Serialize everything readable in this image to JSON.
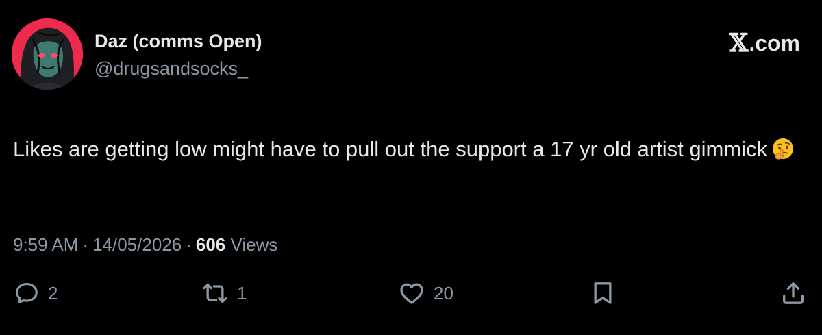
{
  "author": {
    "display_name": "Daz (comms Open)",
    "handle": "@drugsandsocks_"
  },
  "brand": {
    "mark": "𝕏",
    "suffix": ".com"
  },
  "tweet": {
    "text": "Likes are getting low might have to pull out the support a 17 yr old artist gimmick",
    "emoji": "thinking-face"
  },
  "meta": {
    "time": "9:59 AM",
    "separator": "·",
    "date": "14/05/2026",
    "views_count": "606",
    "views_label": "Views"
  },
  "actions": {
    "replies": "2",
    "reposts": "1",
    "likes": "20"
  },
  "colors": {
    "background": "#000000",
    "text": "#e7e9ea",
    "secondary": "#8b98a5",
    "avatar_bg": "#ef2b4d"
  },
  "icons": [
    "reply-icon",
    "repost-icon",
    "like-icon",
    "bookmark-icon",
    "share-icon",
    "thinking-face-emoji"
  ]
}
